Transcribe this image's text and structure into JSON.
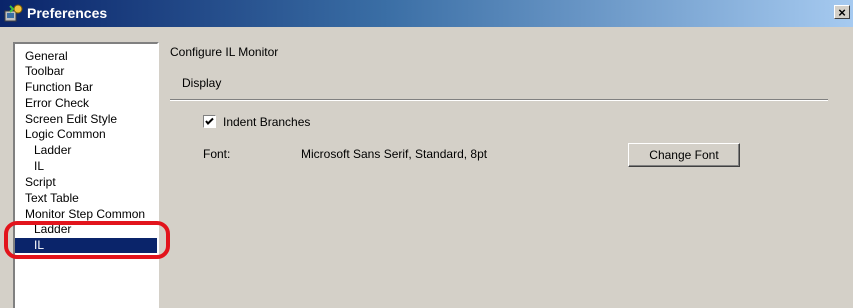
{
  "window": {
    "title": "Preferences",
    "close_label": "×"
  },
  "nav": {
    "items": [
      {
        "label": "General",
        "level": 0,
        "selected": false
      },
      {
        "label": "Toolbar",
        "level": 0,
        "selected": false
      },
      {
        "label": "Function Bar",
        "level": 0,
        "selected": false
      },
      {
        "label": "Error Check",
        "level": 0,
        "selected": false
      },
      {
        "label": "Screen Edit Style",
        "level": 0,
        "selected": false
      },
      {
        "label": "Logic Common",
        "level": 0,
        "selected": false
      },
      {
        "label": "Ladder",
        "level": 1,
        "selected": false
      },
      {
        "label": "IL",
        "level": 1,
        "selected": false
      },
      {
        "label": "Script",
        "level": 0,
        "selected": false
      },
      {
        "label": "Text Table",
        "level": 0,
        "selected": false
      },
      {
        "label": "Monitor Step Common",
        "level": 0,
        "selected": false
      },
      {
        "label": "Ladder",
        "level": 1,
        "selected": false
      },
      {
        "label": "IL",
        "level": 1,
        "selected": true
      }
    ]
  },
  "panel": {
    "title": "Configure IL Monitor",
    "group_label": "Display",
    "indent_branches": {
      "label": "Indent Branches",
      "checked": true
    },
    "font": {
      "label": "Font:",
      "value": "Microsoft Sans Serif, Standard, 8pt",
      "button_label": "Change Font"
    }
  },
  "colors": {
    "selection": "#0a246a",
    "highlight_ring": "#e2141c",
    "dialog_face": "#d4d0c8"
  }
}
